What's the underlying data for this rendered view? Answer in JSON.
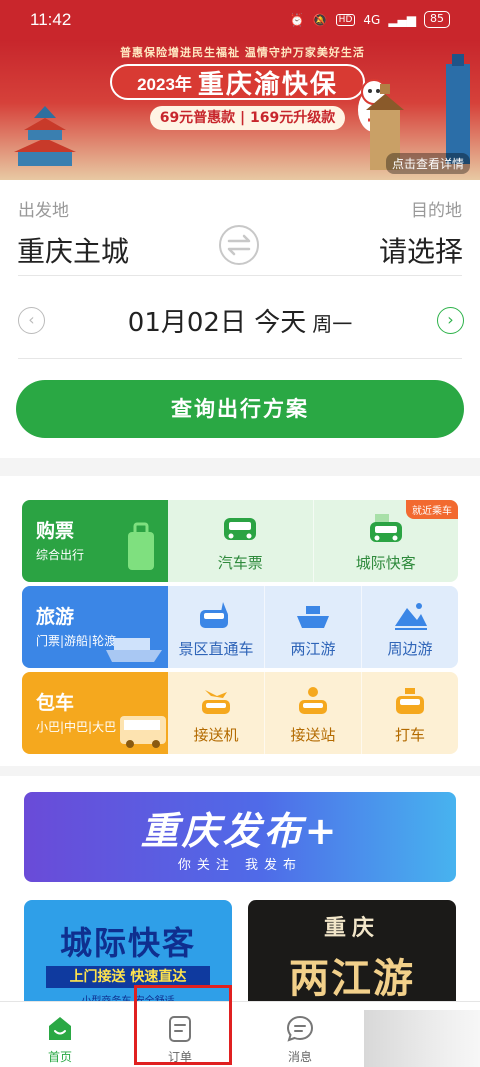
{
  "status_bar": {
    "time": "11:42",
    "network": "4G",
    "battery": "85"
  },
  "banner": {
    "slogan": "普惠保险增进民生福祉 温情守护万家美好生活",
    "year": "2023年",
    "title": "重庆渝快保",
    "price": "69元普惠款 | 169元升级款",
    "detail_link": "点击查看详情"
  },
  "search": {
    "from_label": "出发地",
    "to_label": "目的地",
    "from_city": "重庆主城",
    "to_city": "请选择",
    "date": "01月02日 今天",
    "weekday": "周一",
    "query_button": "查询出行方案"
  },
  "services": {
    "rows": [
      {
        "title": "购票",
        "subtitle": "综合出行",
        "badge": "就近乘车",
        "items": [
          {
            "label": "汽车票",
            "icon": "bus-icon"
          },
          {
            "label": "城际快客",
            "icon": "intercity-icon"
          }
        ]
      },
      {
        "title": "旅游",
        "subtitle": "门票|游船|轮渡",
        "items": [
          {
            "label": "景区直通车",
            "icon": "scenic-bus-icon"
          },
          {
            "label": "两江游",
            "icon": "boat-icon"
          },
          {
            "label": "周边游",
            "icon": "mountain-icon"
          }
        ]
      },
      {
        "title": "包车",
        "subtitle": "小巴|中巴|大巴",
        "items": [
          {
            "label": "接送机",
            "icon": "airport-icon"
          },
          {
            "label": "接送站",
            "icon": "station-icon"
          },
          {
            "label": "打车",
            "icon": "taxi-icon"
          }
        ]
      }
    ]
  },
  "promo": {
    "title": "重庆发布+",
    "subtitle": "你关注 我发布",
    "card_left_title": "城际快客",
    "card_left_sub": "上门接送 快速直达",
    "card_left_fine": "小型商务车 安全舒适",
    "card_right_small": "重庆",
    "card_right_big": "两江游"
  },
  "bottom_nav": {
    "home": "首页",
    "orders": "订单",
    "messages": "消息"
  },
  "colors": {
    "primary_green": "#2aa844",
    "banner_red": "#c9262c",
    "highlight_red": "#e02020"
  }
}
